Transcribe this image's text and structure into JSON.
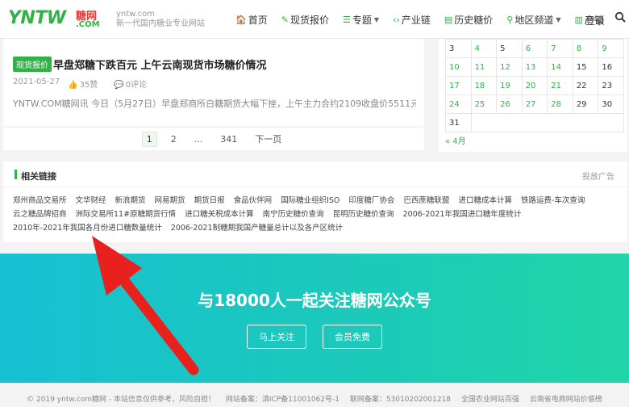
{
  "header": {
    "logo_en": "YNTW",
    "logo_cn": "糖网",
    "logo_com": ".COM",
    "slogan_line1": "yntw.com",
    "slogan_line2": "新一代国内糖业专业网站",
    "nav": [
      {
        "icon": "home-icon",
        "glyph": "🏠",
        "label": "首页"
      },
      {
        "icon": "edit-icon",
        "glyph": "✎",
        "label": "现货报价"
      },
      {
        "icon": "list-icon",
        "glyph": "☰",
        "label": "专题",
        "dropdown": true
      },
      {
        "icon": "code-icon",
        "glyph": "‹›",
        "label": "产业链"
      },
      {
        "icon": "chart-icon",
        "glyph": "▤",
        "label": "历史糖价"
      },
      {
        "icon": "map-pin-icon",
        "glyph": "⚲",
        "label": "地区频道",
        "dropdown": true
      },
      {
        "icon": "bar-chart-icon",
        "glyph": "▥",
        "label": "产销"
      }
    ],
    "login": "登录"
  },
  "article": {
    "badge": "现货报价",
    "title": "早盘郑糖下跌百元 上午云南现货市场糖价情况",
    "date": "2021-05-27",
    "likes": "35赞",
    "comments": "0评论",
    "excerpt": "YNTW.COM糖网讯 今日（5月27日）早盘郑商所白糖期货大幅下挫，上午主力合约2109收盘价5511元，..."
  },
  "pagination": {
    "pages": [
      "1",
      "2",
      "...",
      "341",
      "下一页"
    ],
    "active": "1"
  },
  "calendar": {
    "rows": [
      [
        {
          "d": "3",
          "link": false
        },
        {
          "d": "4",
          "link": true
        },
        {
          "d": "5",
          "link": false
        },
        {
          "d": "6",
          "link": true
        },
        {
          "d": "7",
          "link": true
        },
        {
          "d": "8",
          "link": true
        },
        {
          "d": "9",
          "link": true
        }
      ],
      [
        {
          "d": "10",
          "link": true
        },
        {
          "d": "11",
          "link": true
        },
        {
          "d": "12",
          "link": true
        },
        {
          "d": "13",
          "link": true
        },
        {
          "d": "14",
          "link": true
        },
        {
          "d": "15",
          "link": false
        },
        {
          "d": "16",
          "link": false
        }
      ],
      [
        {
          "d": "17",
          "link": true
        },
        {
          "d": "18",
          "link": true
        },
        {
          "d": "19",
          "link": true
        },
        {
          "d": "20",
          "link": true
        },
        {
          "d": "21",
          "link": true
        },
        {
          "d": "22",
          "link": false
        },
        {
          "d": "23",
          "link": false
        }
      ],
      [
        {
          "d": "24",
          "link": true
        },
        {
          "d": "25",
          "link": true
        },
        {
          "d": "26",
          "link": true
        },
        {
          "d": "27",
          "link": true
        },
        {
          "d": "28",
          "link": true
        },
        {
          "d": "29",
          "link": false
        },
        {
          "d": "30",
          "link": false
        }
      ],
      [
        {
          "d": "31",
          "link": false
        }
      ]
    ],
    "prev_month": "« 4月"
  },
  "related_links": {
    "title": "相关链接",
    "ad": "投放广告",
    "links": [
      "郑州商品交易所",
      "文华财经",
      "新浪期货",
      "网易期货",
      "期货日报",
      "食品伙伴网",
      "国际糖业组织ISO",
      "印度糖厂协会",
      "巴西蔗糖联盟",
      "进口糖成本计算",
      "铁路运费-车次查询",
      "云之糖品牌招商",
      "洲际交易所11#原糖期货行情",
      "进口糖关税成本计算",
      "南宁历史糖价查询",
      "昆明历史糖价查询",
      "2006-2021年我国进口糖年度统计",
      "2010年-2021年我国各月份进口糖数量统计",
      "2006-2021制糖期我国产糖量总计以及各产区统计"
    ]
  },
  "banner": {
    "title": "与18000人一起关注糖网公众号",
    "follow": "马上关注",
    "member": "会员免费"
  },
  "footer": {
    "copyright": "© 2019 yntw.com糖网 - 本站信息仅供参考，风险自担！",
    "record1": "网站备案：滇ICP备11001062号-1",
    "record2": "联网备案：53010202001218",
    "award1": "全国农业网站百强",
    "award2": "云南省电商网站价值榜"
  },
  "colors": {
    "brand_green": "#2fb344",
    "logo_red": "#e53935",
    "banner_start": "#17c0d3",
    "banner_end": "#20d6a8",
    "annotation_arrow": "#e8211f"
  }
}
